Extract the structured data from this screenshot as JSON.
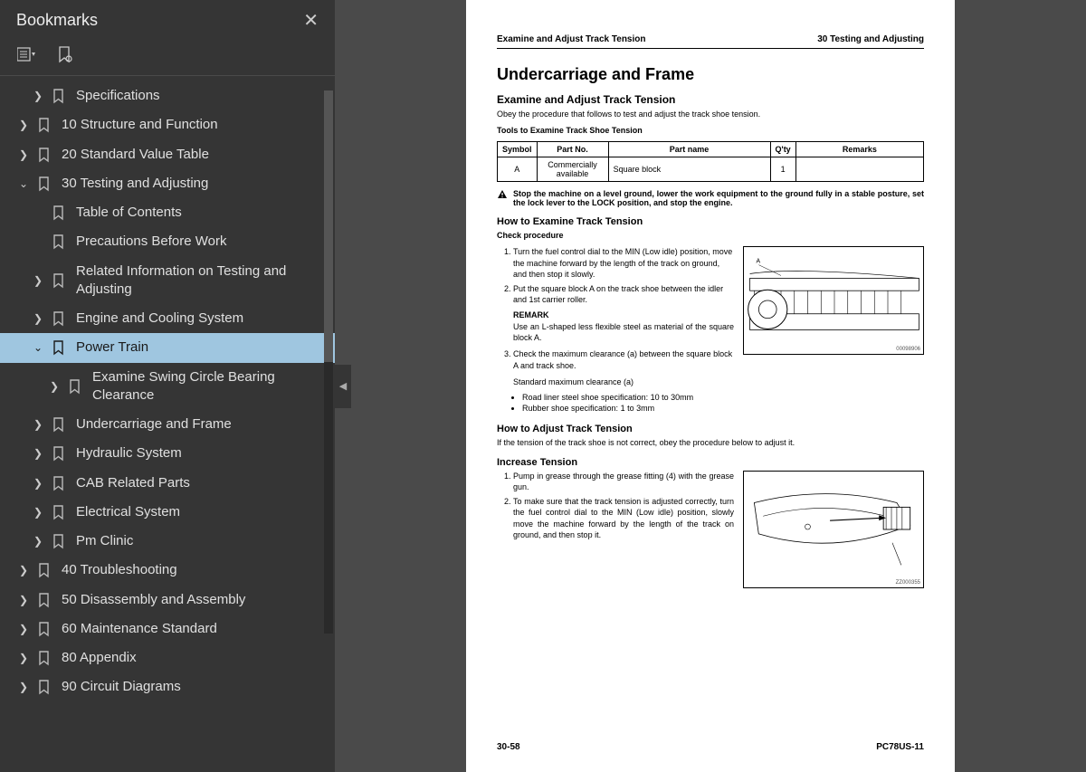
{
  "sidebar": {
    "title": "Bookmarks",
    "items": [
      {
        "label": "Specifications",
        "level": 1,
        "expand": "right"
      },
      {
        "label": "10 Structure and Function",
        "level": 0,
        "expand": "right"
      },
      {
        "label": "20 Standard Value Table",
        "level": 0,
        "expand": "right"
      },
      {
        "label": "30 Testing and Adjusting",
        "level": 0,
        "expand": "down"
      },
      {
        "label": "Table of Contents",
        "level": 1,
        "expand": "none"
      },
      {
        "label": "Precautions Before Work",
        "level": 1,
        "expand": "none"
      },
      {
        "label": "Related Information on Testing and Adjusting",
        "level": 1,
        "expand": "right"
      },
      {
        "label": "Engine and Cooling System",
        "level": 1,
        "expand": "right"
      },
      {
        "label": "Power Train",
        "level": 1,
        "expand": "down",
        "selected": true
      },
      {
        "label": "Examine Swing Circle Bearing Clearance",
        "level": 2,
        "expand": "right"
      },
      {
        "label": "Undercarriage and Frame",
        "level": 1,
        "expand": "right"
      },
      {
        "label": "Hydraulic System",
        "level": 1,
        "expand": "right"
      },
      {
        "label": "CAB Related Parts",
        "level": 1,
        "expand": "right"
      },
      {
        "label": "Electrical System",
        "level": 1,
        "expand": "right"
      },
      {
        "label": "Pm Clinic",
        "level": 1,
        "expand": "right"
      },
      {
        "label": "40 Troubleshooting",
        "level": 0,
        "expand": "right"
      },
      {
        "label": "50 Disassembly and Assembly",
        "level": 0,
        "expand": "right"
      },
      {
        "label": "60 Maintenance Standard",
        "level": 0,
        "expand": "right"
      },
      {
        "label": "80 Appendix",
        "level": 0,
        "expand": "right"
      },
      {
        "label": "90 Circuit Diagrams",
        "level": 0,
        "expand": "right"
      }
    ]
  },
  "page": {
    "headerLeft": "Examine and Adjust Track Tension",
    "headerRight": "30 Testing and Adjusting",
    "h1": "Undercarriage and Frame",
    "h2a": "Examine and Adjust Track Tension",
    "pIntro": "Obey the procedure that follows to test and adjust the track shoe tension.",
    "toolsTitle": "Tools to Examine Track Shoe Tension",
    "table": {
      "headers": [
        "Symbol",
        "Part No.",
        "Part name",
        "Q'ty",
        "Remarks"
      ],
      "row": {
        "symbol": "A",
        "partNo": "Commercially available",
        "partName": "Square block",
        "qty": "1",
        "remarks": ""
      }
    },
    "warning": "Stop the machine on a level ground, lower the work equipment to the ground fully in a stable posture, set the lock lever to the LOCK position, and stop the engine.",
    "howExamine": "How to Examine Track Tension",
    "checkProc": "Check procedure",
    "steps1": [
      "Turn the fuel control dial to the MIN (Low idle) position, move the machine forward by the length of the track on ground, and then stop it slowly.",
      "Put the square block A on the track shoe between the idler and 1st carrier roller."
    ],
    "remarkLabel": "REMARK",
    "remarkText": "Use an L-shaped less flexible steel as material of the square block A.",
    "step3": "Check the maximum clearance (a) between the square block A and track shoe.",
    "stdMax": "Standard maximum clearance (a)",
    "bullets": [
      "Road liner steel shoe specification: 10 to 30mm",
      "Rubber shoe specification: 1 to 3mm"
    ],
    "fig1Id": "00098906",
    "howAdjust": "How to Adjust Track Tension",
    "adjustIntro": "If the tension of the track shoe is not correct, obey the procedure below to adjust it.",
    "increase": "Increase Tension",
    "steps2": [
      "Pump in grease through the grease fitting (4) with the grease gun.",
      "To make sure that the track tension is adjusted correctly, turn the fuel control dial to the MIN (Low idle) position, slowly move the machine forward by the length of the track on ground, and then stop it."
    ],
    "fig2Id": "ZZ000355",
    "footerLeft": "30-58",
    "footerRight": "PC78US-11"
  }
}
